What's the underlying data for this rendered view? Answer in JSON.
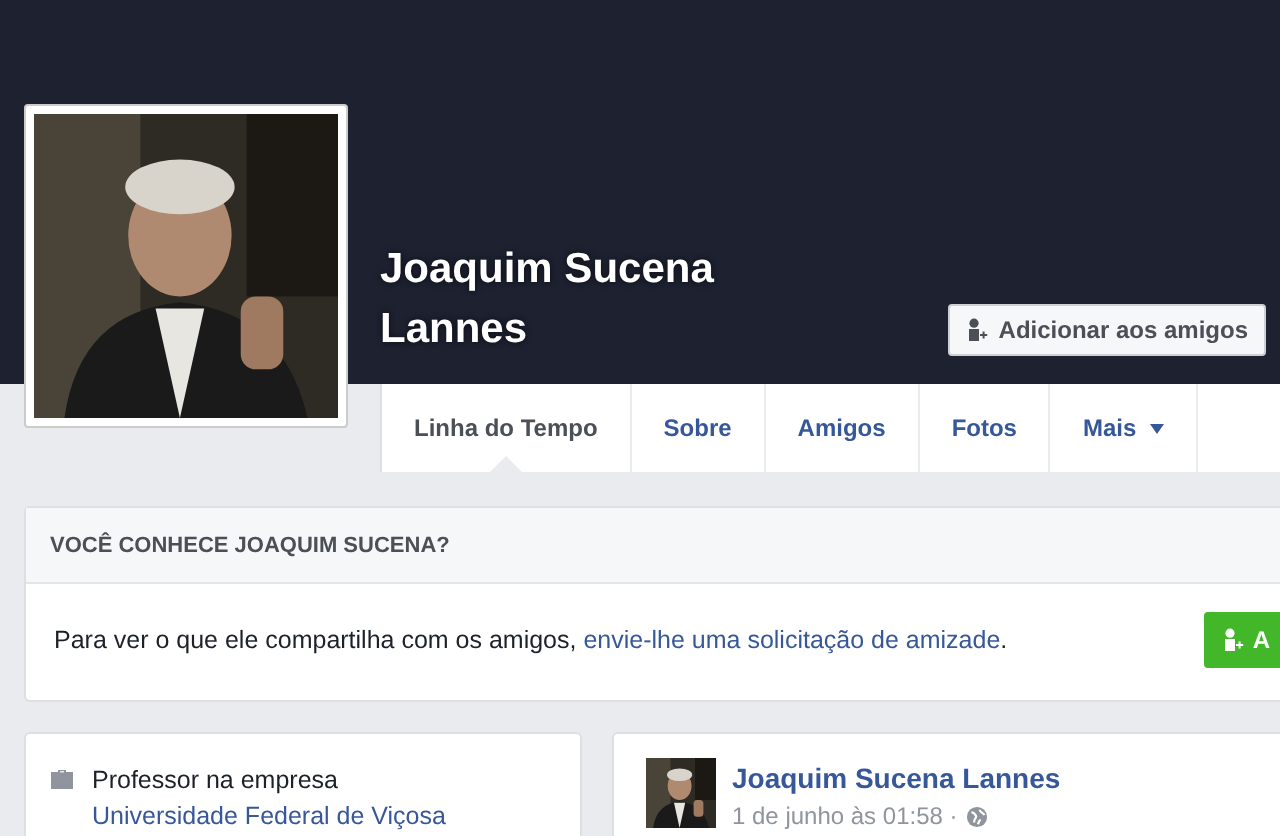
{
  "profile": {
    "name": "Joaquim Sucena Lannes",
    "add_friend_button": "Adicionar aos amigos",
    "tabs": [
      {
        "label": "Linha do Tempo",
        "selected": true,
        "dropdown": false
      },
      {
        "label": "Sobre",
        "selected": false,
        "dropdown": false
      },
      {
        "label": "Amigos",
        "selected": false,
        "dropdown": false
      },
      {
        "label": "Fotos",
        "selected": false,
        "dropdown": false
      },
      {
        "label": "Mais",
        "selected": false,
        "dropdown": true
      }
    ]
  },
  "know_card": {
    "title": "VOCÊ CONHECE JOAQUIM SUCENA?",
    "text": "Para ver o que ele compartilha com os amigos, ",
    "link": "envie-lhe uma solicitação de amizade",
    "after": ".",
    "button": "A"
  },
  "intro": {
    "items": [
      {
        "text": "Professor na empresa ",
        "link": "Universidade Federal de Viçosa"
      }
    ]
  },
  "post": {
    "author": "Joaquim Sucena Lannes",
    "time": "1 de junho às 01:58 ·"
  }
}
